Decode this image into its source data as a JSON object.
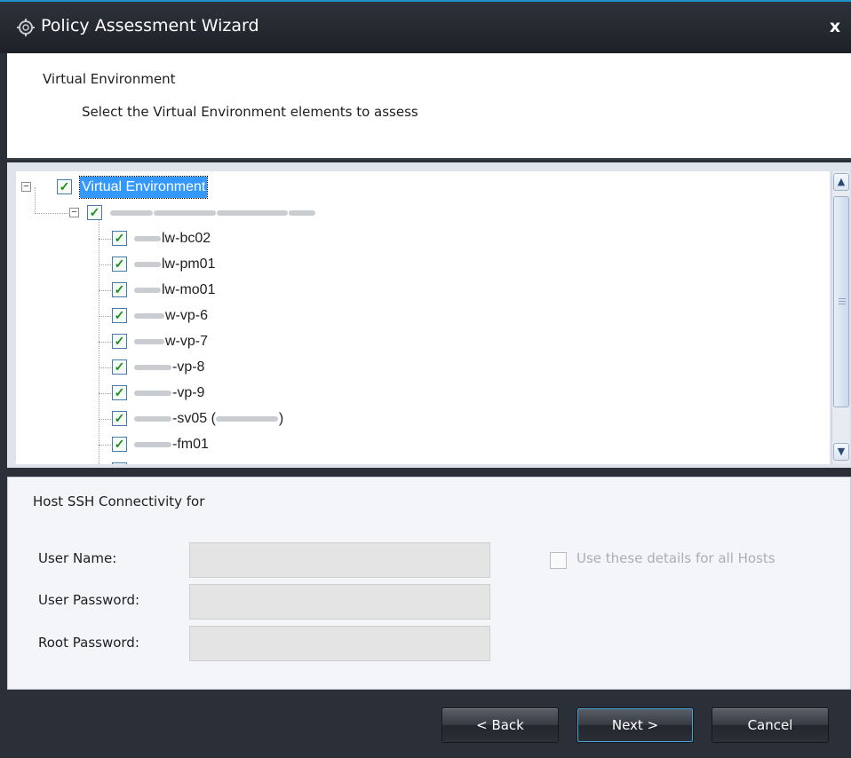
{
  "window": {
    "title": "Policy Assessment Wizard",
    "close_glyph": "x",
    "icon": "wizard-gear-icon"
  },
  "header": {
    "title": "Virtual Environment",
    "subtitle": "Select the Virtual Environment elements to assess"
  },
  "tree": {
    "root": {
      "label": "Virtual Environment",
      "checked": true,
      "expanded": true,
      "expander": "−"
    },
    "server": {
      "label_suffix": "",
      "checked": true,
      "expanded": true,
      "expander": "−"
    },
    "hosts": [
      {
        "visible_text": "lw-bc02",
        "checked": true
      },
      {
        "visible_text": "lw-pm01",
        "checked": true
      },
      {
        "visible_text": "lw-mo01",
        "checked": true
      },
      {
        "visible_text": "w-vp-6",
        "checked": true
      },
      {
        "visible_text": "w-vp-7",
        "checked": true
      },
      {
        "visible_text": "-vp-8",
        "checked": true
      },
      {
        "visible_text": "-vp-9",
        "checked": true
      },
      {
        "visible_text": "-sv05 (",
        "visible_text_after": ")",
        "checked": true
      },
      {
        "visible_text": "-fm01",
        "checked": true
      }
    ],
    "check_glyph": "✓"
  },
  "scrollbar": {
    "up_glyph": "▲",
    "down_glyph": "▼"
  },
  "ssh": {
    "title": "Host SSH Connectivity for",
    "user_name_label": "User Name:",
    "user_password_label": "User Password:",
    "root_password_label": "Root Password:",
    "use_all_hosts_label": "Use these details for all Hosts",
    "use_all_hosts_checked": false,
    "user_name_value": "",
    "user_password_value": "",
    "root_password_value": ""
  },
  "footer": {
    "back_label": "< Back",
    "next_label": "Next >",
    "cancel_label": "Cancel"
  }
}
